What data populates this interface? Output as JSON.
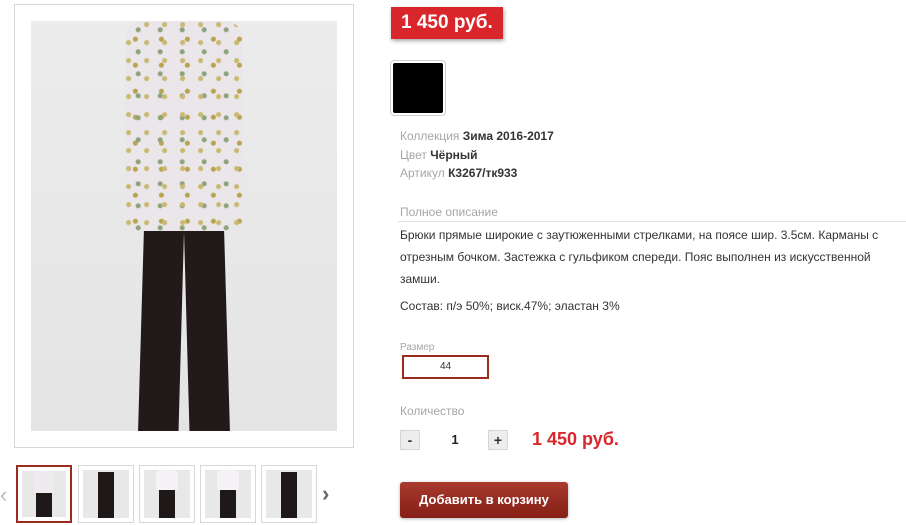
{
  "gallery": {
    "prev_icon": "‹",
    "next_icon": "›",
    "thumbnails": [
      {
        "name": "thumb-1",
        "active": true
      },
      {
        "name": "thumb-2",
        "active": false
      },
      {
        "name": "thumb-3",
        "active": false
      },
      {
        "name": "thumb-4",
        "active": false
      },
      {
        "name": "thumb-5",
        "active": false
      }
    ]
  },
  "product": {
    "price": "1 450 руб.",
    "color_swatch": "#000000",
    "attributes": {
      "collection_label": "Коллекция",
      "collection_value": "Зима 2016-2017",
      "color_label": "Цвет",
      "color_value": "Чёрный",
      "article_label": "Артикул",
      "article_value": "К3267/тк933"
    },
    "description": {
      "label": "Полное описание",
      "text": "Брюки прямые широкие с заутюженными стрелками, на поясе шир. 3.5см. Карманы с отрезным бочком. Застежка с гульфиком спереди. Пояс выполнен из искусственной замши.",
      "composition": "Состав: п/э 50%; виск.47%; эластан 3%"
    },
    "size": {
      "label": "Размер",
      "selected": "44"
    },
    "quantity": {
      "label": "Количество",
      "minus": "-",
      "value": "1",
      "plus": "+",
      "total": "1 450 руб."
    },
    "add_to_cart": "Добавить в корзину"
  },
  "colors": {
    "accent_red": "#d9262b",
    "button_brown": "#861f16",
    "selected_border": "#9a2b1f"
  }
}
